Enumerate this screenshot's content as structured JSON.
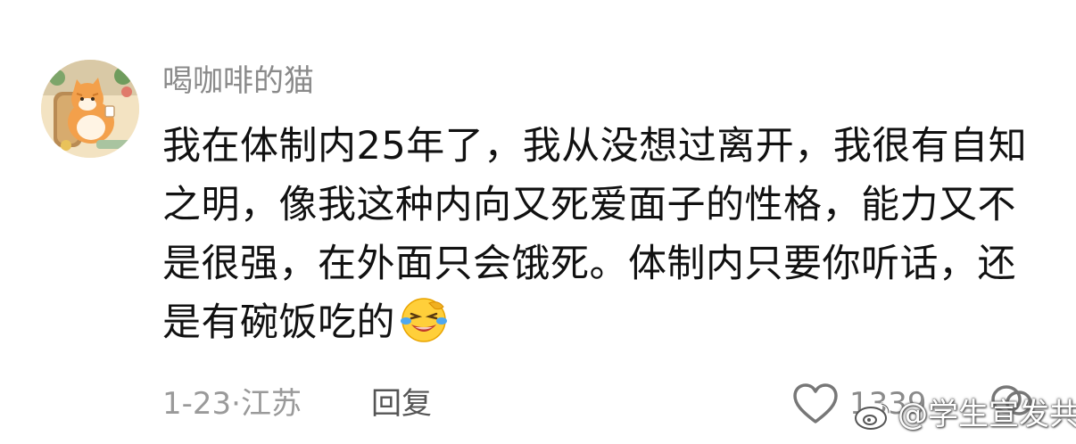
{
  "comment": {
    "username": "喝咖啡的猫",
    "text_lines": [
      "我在体制内25年了，我从没想过离开，我很有自知",
      "之明，像我这种内向又死爱面子的性格，能力又不",
      "是很强，在外面只会饿死。体制内只要你听话，还",
      "是有碗饭吃的"
    ],
    "emoji": "laughing-crying-emoji",
    "date": "1-23",
    "separator": "·",
    "location": "江苏",
    "reply_label": "回复",
    "like_count": "1339"
  },
  "watermark": {
    "text": "@学生宣发共使"
  },
  "icons": {
    "like": "heart-outline-icon",
    "more": "comment-bubbles-icon"
  },
  "colors": {
    "username": "#8a8a8a",
    "text": "#111111",
    "meta": "#9a9a9a",
    "reply": "#555555"
  }
}
